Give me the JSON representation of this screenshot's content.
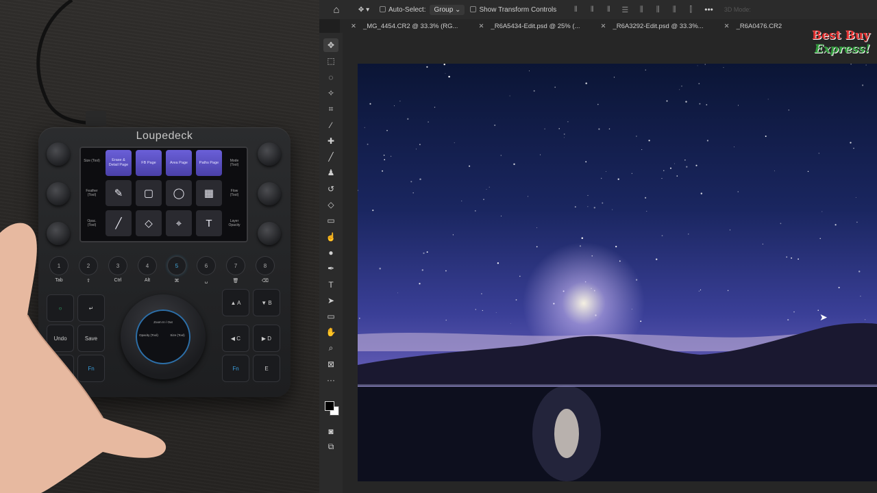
{
  "device": {
    "brand": "Loupedeck",
    "screen": {
      "left_labels": [
        "Size (Tool)",
        "Feather (Tool)",
        "Opac. (Tool)"
      ],
      "right_labels": [
        "Mode (Tool)",
        "Flow (Tool)",
        "Layer Opacity"
      ],
      "page_buttons": [
        "Erase & Detail Page",
        "FB Page",
        "Area Page",
        "Paths Page"
      ],
      "tool_glyphs": [
        "✎",
        "▢",
        "◯",
        "▦",
        "╱",
        "◇",
        "⌖",
        "T"
      ]
    },
    "number_buttons": [
      "1",
      "2",
      "3",
      "4",
      "5",
      "6",
      "7",
      "8"
    ],
    "modifiers": [
      "Tab",
      "⇧",
      "Ctrl",
      "Alt",
      "⌘",
      "␣",
      "🗑",
      "⌫"
    ],
    "left_keys": [
      "○",
      "↵",
      "Undo",
      "Save",
      "⌨",
      "Fn"
    ],
    "right_keys": [
      "▲ A",
      "▼ B",
      "◀ C",
      "▶ D",
      "Fn",
      "E"
    ],
    "dial": {
      "top": "Zoom In / Out",
      "left": "Opacity (Tool)",
      "right": "Size (Tool)"
    }
  },
  "photoshop": {
    "options_bar": {
      "auto_select_label": "Auto-Select:",
      "auto_select_value": "Group",
      "transform_label": "Show Transform Controls",
      "mode3d_label": "3D Mode:",
      "more": "•••"
    },
    "doc_tabs": [
      "_MG_4454.CR2 @ 33.3% (RG...",
      "_R6A5434-Edit.psd @ 25% (...",
      "_R6A3292-Edit.psd @ 33.3%...",
      "_R6A0476.CR2"
    ],
    "tools": [
      "move-icon",
      "marquee-icon",
      "lasso-icon",
      "magic-wand-icon",
      "crop-icon",
      "eyedropper-icon",
      "healing-icon",
      "brush-icon",
      "clone-stamp-icon",
      "history-brush-icon",
      "eraser-icon",
      "gradient-icon",
      "smudge-icon",
      "dodge-icon",
      "pen-icon",
      "type-icon",
      "path-select-icon",
      "rectangle-icon",
      "hand-icon",
      "zoom-icon",
      "frame-icon",
      "more-tools-icon"
    ],
    "tool_glyphs": [
      "✥",
      "⬚",
      "◌",
      "✧",
      "⌗",
      "⁄",
      "✚",
      "╱",
      "♟",
      "↺",
      "◇",
      "▭",
      "☝",
      "●",
      "✒",
      "T",
      "➤",
      "▭",
      "✋",
      "⌕",
      "⊠",
      "···"
    ]
  },
  "watermark": {
    "line1": "Best Buy",
    "line2": "Express!"
  },
  "colors": {
    "device_page_button": "#5a50c8",
    "fg_color": "#000000",
    "bg_color": "#ffffff",
    "sky_top": "#0b1535",
    "sky_horizon": "#8a7fc4"
  }
}
